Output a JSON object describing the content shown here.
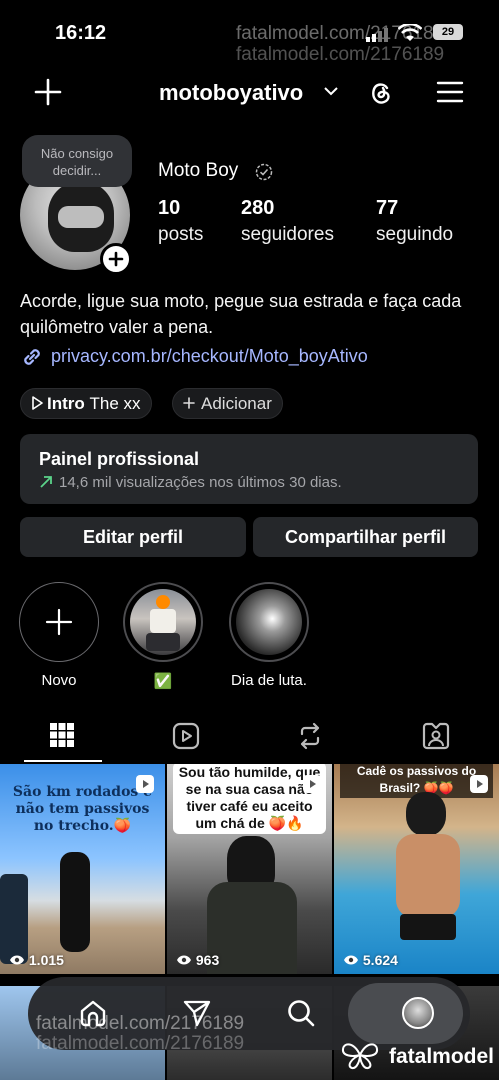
{
  "status_bar": {
    "time": "16:12",
    "battery": "29",
    "watermark": "fatalmodel.com/2176189"
  },
  "header": {
    "username": "motoboyativo"
  },
  "profile": {
    "note": "Não consigo decidir...",
    "display_name": "Moto Boy",
    "stats": [
      {
        "value": "10",
        "label": "posts"
      },
      {
        "value": "280",
        "label": "seguidores"
      },
      {
        "value": "77",
        "label": "seguindo"
      }
    ],
    "bio": "Acorde, ligue sua moto, pegue sua estrada e faça cada quilômetro valer a pena.",
    "link": "privacy.com.br/checkout/Moto_boyAtivo",
    "music_chip": {
      "bold": "Intro",
      "artist": "The xx"
    },
    "add_chip": "Adicionar"
  },
  "dashboard": {
    "title": "Painel profissional",
    "subtitle": "14,6 mil visualizações nos últimos 30 dias."
  },
  "buttons": {
    "edit": "Editar perfil",
    "share": "Compartilhar perfil"
  },
  "highlights": [
    {
      "label": "Novo"
    },
    {
      "label": "✅"
    },
    {
      "label": "Dia de luta."
    }
  ],
  "posts": [
    {
      "caption": "São km rodados e não tem passivos no trecho.🍑",
      "views": "1.015"
    },
    {
      "caption": "Sou tão humilde, que se na sua casa não tiver café eu aceito um chá de 🍑🔥",
      "views": "963"
    },
    {
      "caption": "Cadê os passivos do Brasil? 🍑🍑",
      "views": "5.624"
    }
  ],
  "footer": {
    "watermark": "fatalmodel.com/2176189",
    "brand": "fatalmodel"
  },
  "colors": {
    "accent_link": "#a6b7ff",
    "card_bg": "#25272a",
    "trend_green": "#5bd38a"
  }
}
